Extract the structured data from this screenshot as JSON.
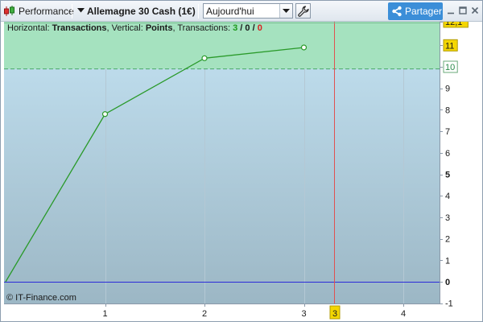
{
  "toolbar": {
    "performance_label": "Performance",
    "instrument_label": "Allemagne 30 Cash (1€)",
    "period_value": "Aujourd'hui",
    "share_label": "Partager",
    "icons": {
      "performance": "candlestick-icon",
      "instrument_menu": "triangle-down-icon",
      "dropdown": "chevron-down-icon",
      "settings": "wrench-icon",
      "share": "share-icon",
      "minimize": "minimize-icon",
      "maximize": "maximize-icon",
      "close": "close-icon"
    }
  },
  "info": {
    "horizontal_label": "Horizontal:",
    "horizontal_value": "Transactions",
    "vertical_label": "Vertical:",
    "vertical_value": "Points",
    "transactions_label": "Transactions:",
    "wins": "3",
    "sep1": "/",
    "neutral": "0",
    "sep2": "/",
    "losses": "0"
  },
  "copyright": "© IT-Finance.com",
  "colors": {
    "line": "#2a9a2a",
    "profit_zone": "#a5e2bf",
    "gain_label_bg": "#f4d600",
    "cursor_line": "#e05050",
    "zero_line": "#2a2ad8",
    "wins_text": "#1d9a1d",
    "losses_text": "#d82020"
  },
  "chart_data": {
    "type": "line",
    "x": [
      0,
      1,
      2,
      3
    ],
    "values": [
      0,
      7.8,
      10.4,
      10.9
    ],
    "xlim": [
      0,
      4.4
    ],
    "ylim": [
      -1,
      12.3
    ],
    "x_ticks": [
      "1",
      "2",
      "3",
      "4"
    ],
    "y_ticks": [
      "-1",
      "0",
      "1",
      "2",
      "3",
      "4",
      "5",
      "6",
      "7",
      "8",
      "9",
      "10",
      "11",
      "12,1"
    ],
    "grid": true,
    "cursor_x": 3.3,
    "cursor_x_label": "3",
    "target_value": 9.9,
    "target_label": "10",
    "current_value": 11,
    "current_label": "11",
    "max_label": "12,1",
    "zero_value": 0
  }
}
